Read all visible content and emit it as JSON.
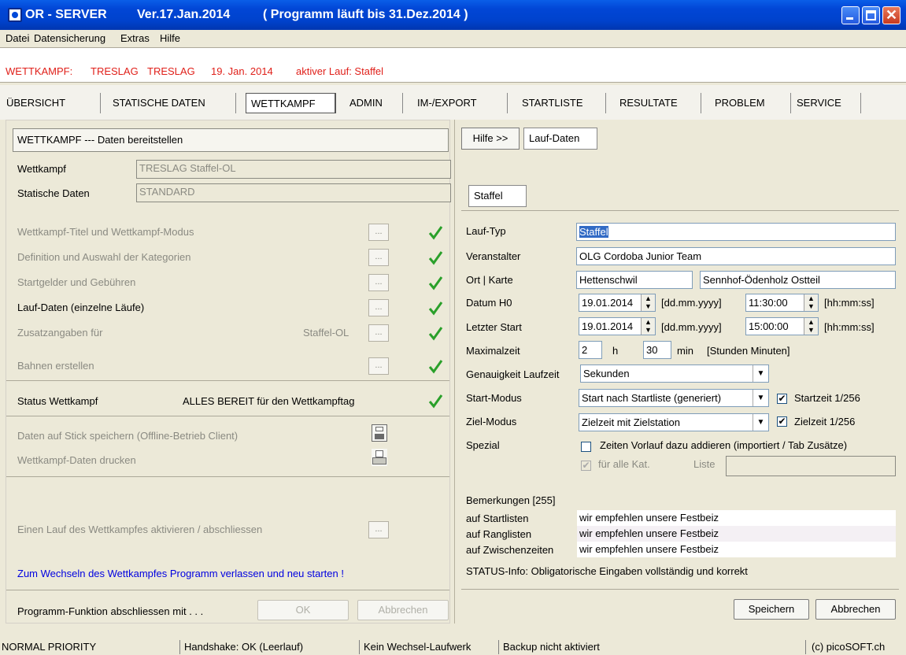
{
  "window": {
    "title": "OR - SERVER",
    "version": "Ver.17.Jan.2014",
    "runtime": "( Programm läuft bis 31.Dez.2014 )"
  },
  "menu": [
    "Datei",
    "Datensicherung",
    "Extras",
    "Hilfe"
  ],
  "wettkampf_line": {
    "label": "WETTKAMPF:",
    "name1": "TRESLAG",
    "name2": "TRESLAG",
    "date": "19. Jan. 2014",
    "active": "aktiver Lauf: Staffel"
  },
  "tabs": [
    "ÜBERSICHT",
    "STATISCHE DATEN",
    "WETTKAMPF",
    "ADMIN",
    "IM-/EXPORT",
    "STARTLISTE",
    "RESULTATE",
    "PROBLEM",
    "SERVICE"
  ],
  "left": {
    "header": "WETTKAMPF --- Daten bereitstellen",
    "wettkampf_label": "Wettkampf",
    "wettkampf_value": "TRESLAG   Staffel-OL",
    "statdaten_label": "Statische Daten",
    "statdaten_value": "STANDARD",
    "steps": [
      "Wettkampf-Titel und Wettkampf-Modus",
      "Definition und Auswahl der Kategorien",
      "Startgelder und Gebühren",
      "Lauf-Daten (einzelne Läufe)",
      "Zusatzangaben für",
      "Bahnen erstellen"
    ],
    "zusatz_right": "Staffel-OL",
    "dots": "...",
    "status_label": "Status Wettkampf",
    "status_value": "ALLES BEREIT für den Wettkampftag",
    "stick": "Daten auf Stick speichern (Offline-Betrieb Client)",
    "print": "Wettkampf-Daten drucken",
    "activate": "Einen Lauf des Wettkampfes aktivieren / abschliessen",
    "restart_note": "Zum Wechseln des Wettkampfes Programm verlassen und neu starten !",
    "finish_label": "Programm-Funktion abschliessen mit . . .",
    "ok": "OK",
    "cancel": "Abbrechen"
  },
  "right": {
    "hilfe": "Hilfe >>",
    "laufdaten_tab": "Lauf-Daten",
    "staffel_tab": "Staffel",
    "lauftyp_label": "Lauf-Typ",
    "lauftyp": "Staffel",
    "veranstalter_label": "Veranstalter",
    "veranstalter": "OLG Cordoba Junior Team",
    "ort_label": "Ort | Karte",
    "ort": "Hettenschwil",
    "karte": "Sennhof-Ödenholz Ostteil",
    "datum_label": "Datum  H0",
    "datum": "19.01.2014",
    "datum_fmt": "[dd.mm.yyyy]",
    "h0": "11:30:00",
    "time_fmt": "[hh:mm:ss]",
    "letzter_label": "Letzter Start",
    "letzter_datum": "19.01.2014",
    "letzter_zeit": "15:00:00",
    "max_label": "Maximalzeit",
    "max_h": "2",
    "h": "h",
    "max_min": "30",
    "min": "min",
    "max_hint": "[Stunden Minuten]",
    "genau_label": "Genauigkeit Laufzeit",
    "genau": "Sekunden",
    "start_label": "Start-Modus",
    "start": "Start nach Startliste (generiert)",
    "start_cb": "Startzeit 1/256",
    "ziel_label": "Ziel-Modus",
    "ziel": "Zielzeit mit Zielstation",
    "ziel_cb": "Zielzeit 1/256",
    "spezial_label": "Spezial",
    "spezial_cb": "Zeiten Vorlauf dazu addieren (importiert / Tab Zusätze)",
    "alle_kat": "für alle Kat.",
    "liste": "Liste",
    "bem_title": "Bemerkungen [255]",
    "bem": [
      {
        "label": "auf Startlisten",
        "text": "wir empfehlen unsere Festbeiz"
      },
      {
        "label": "auf Ranglisten",
        "text": "wir empfehlen unsere Festbeiz"
      },
      {
        "label": "auf Zwischenzeiten",
        "text": "wir empfehlen unsere Festbeiz"
      }
    ],
    "status_info": "STATUS-Info:  Obligatorische Eingaben vollständig und korrekt",
    "save": "Speichern",
    "cancel": "Abbrechen"
  },
  "statusbar": [
    "NORMAL PRIORITY",
    "Handshake: OK (Leerlauf)",
    "Kein Wechsel-Laufwerk",
    "Backup nicht aktiviert",
    "(c) picoSOFT.ch"
  ],
  "colors": {
    "title_blue": "#0042cc",
    "red_text": "#e0201a",
    "check_green": "#2aa02a",
    "link_blue": "#0000e0"
  }
}
